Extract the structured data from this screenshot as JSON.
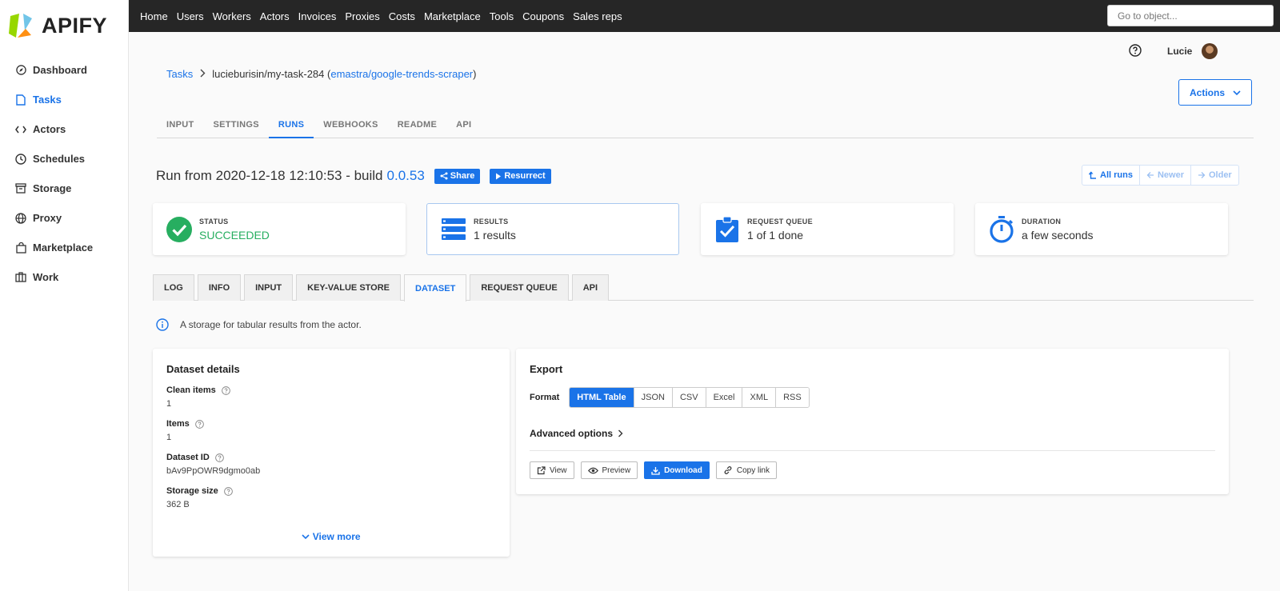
{
  "brand": {
    "name": "APIFY"
  },
  "sidebar": {
    "items": [
      {
        "label": "Dashboard",
        "icon": "dashboard-icon"
      },
      {
        "label": "Tasks",
        "icon": "tasks-icon",
        "active": true
      },
      {
        "label": "Actors",
        "icon": "actors-icon"
      },
      {
        "label": "Schedules",
        "icon": "schedules-icon"
      },
      {
        "label": "Storage",
        "icon": "storage-icon"
      },
      {
        "label": "Proxy",
        "icon": "proxy-icon"
      },
      {
        "label": "Marketplace",
        "icon": "marketplace-icon"
      },
      {
        "label": "Work",
        "icon": "work-icon"
      }
    ]
  },
  "topbar": {
    "links": [
      "Home",
      "Users",
      "Workers",
      "Actors",
      "Invoices",
      "Proxies",
      "Costs",
      "Marketplace",
      "Tools",
      "Coupons",
      "Sales reps"
    ],
    "search_placeholder": "Go to object..."
  },
  "user": {
    "name": "Lucie"
  },
  "breadcrumb": {
    "root": "Tasks",
    "task": "lucieburisin/my-task-284",
    "open_paren": "(",
    "actor": "emastra/google-trends-scraper",
    "close_paren": ")"
  },
  "actions_label": "Actions",
  "task_tabs": [
    "INPUT",
    "SETTINGS",
    "RUNS",
    "WEBHOOKS",
    "README",
    "API"
  ],
  "task_tab_active": "RUNS",
  "run": {
    "title": "Run from 2020-12-18 12:10:53 - build",
    "build": "0.0.53",
    "share_label": "Share",
    "resurrect_label": "Resurrect",
    "nav": {
      "all": "All runs",
      "newer": "Newer",
      "older": "Older"
    }
  },
  "stats": [
    {
      "label": "STATUS",
      "value": "SUCCEEDED",
      "icon": "check-circle-icon"
    },
    {
      "label": "RESULTS",
      "value": "1 results",
      "icon": "results-list-icon"
    },
    {
      "label": "REQUEST QUEUE",
      "value": "1 of 1 done",
      "icon": "clipboard-check-icon"
    },
    {
      "label": "DURATION",
      "value": "a few seconds",
      "icon": "stopwatch-icon"
    }
  ],
  "run_tabs": [
    "LOG",
    "INFO",
    "INPUT",
    "KEY-VALUE STORE",
    "DATASET",
    "REQUEST QUEUE",
    "API"
  ],
  "run_tab_active": "DATASET",
  "info_text": "A storage for tabular results from the actor.",
  "dataset": {
    "title": "Dataset details",
    "fields": [
      {
        "label": "Clean items",
        "value": "1"
      },
      {
        "label": "Items",
        "value": "1"
      },
      {
        "label": "Dataset ID",
        "value": "bAv9PpOWR9dgmo0ab"
      },
      {
        "label": "Storage size",
        "value": "362 B"
      }
    ],
    "view_more": "View more"
  },
  "export": {
    "title": "Export",
    "format_label": "Format",
    "formats": [
      "HTML Table",
      "JSON",
      "CSV",
      "Excel",
      "XML",
      "RSS"
    ],
    "active_format": "HTML Table",
    "advanced_label": "Advanced options",
    "buttons": {
      "view": "View",
      "preview": "Preview",
      "download": "Download",
      "copy": "Copy link"
    }
  },
  "colors": {
    "accent": "#1a73e8",
    "success": "#27ae60",
    "topbar": "#262626"
  }
}
